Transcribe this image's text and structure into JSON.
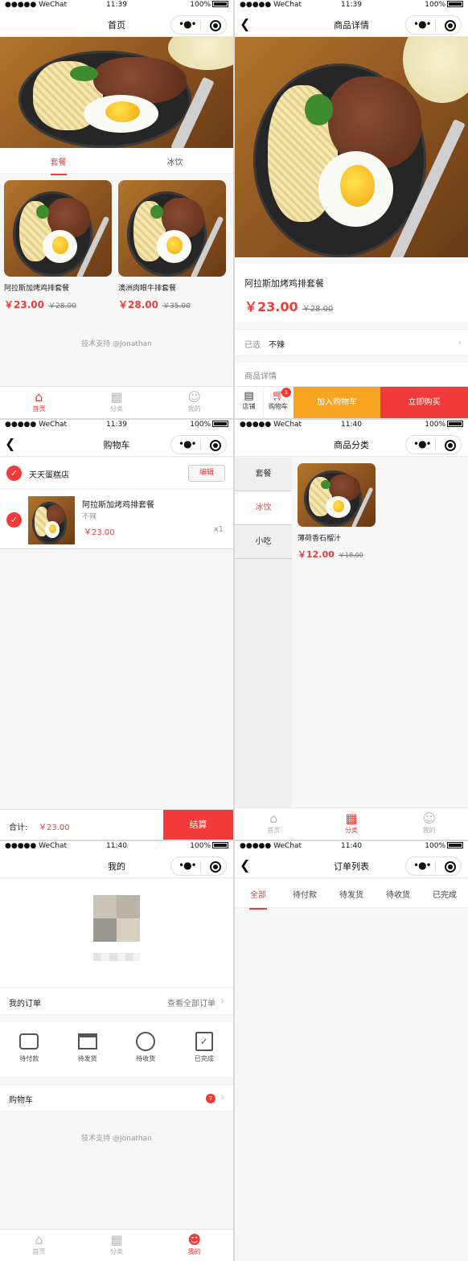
{
  "status": {
    "carrier": "●●●●● WeChat",
    "wifi": "ᯤ",
    "battery": "100%",
    "time_1": "11:39",
    "time_2": "11:39",
    "time_3": "11:39",
    "time_4": "11:40",
    "time_5": "11:40",
    "time_6": "11:40"
  },
  "home": {
    "title": "首页",
    "tabs": [
      "套餐",
      "冰饮"
    ],
    "products": [
      {
        "name": "阿拉斯加烤鸡排套餐",
        "price": "￥23.00",
        "old": "￥28.00"
      },
      {
        "name": "澳洲肉眼牛排套餐",
        "price": "￥28.00",
        "old": "￥35.00"
      }
    ],
    "footer": "技术支持 @Jonathan"
  },
  "detail": {
    "title": "商品详情",
    "name": "阿拉斯加烤鸡排套餐",
    "price": "￥23.00",
    "old": "￥28.00",
    "selected_label": "已选",
    "selected_value": "不辣",
    "detail_label": "商品详情",
    "shop": "店铺",
    "cart": "购物车",
    "cart_badge": "1",
    "add_cart": "加入购物车",
    "buy_now": "立即购买"
  },
  "cart": {
    "title": "购物车",
    "shop": "天天蛋糕店",
    "edit": "编辑",
    "item": {
      "name": "阿拉斯加烤鸡排套餐",
      "spec": "不辣",
      "price": "￥23.00",
      "qty": "x1"
    },
    "total_label": "合计:",
    "total": "￥23.00",
    "checkout": "结算"
  },
  "category": {
    "title": "商品分类",
    "cats": [
      "套餐",
      "冰饮",
      "小吃"
    ],
    "product": {
      "name": "薄荷香石榴汁",
      "price": "￥12.00",
      "old": "￥18.00"
    }
  },
  "mine": {
    "title": "我的",
    "orders_label": "我的订单",
    "view_all": "查看全部订单",
    "order_icons": [
      {
        "label": "待付款",
        "icon": "wallet-icon"
      },
      {
        "label": "待发货",
        "icon": "box-icon"
      },
      {
        "label": "待收货",
        "icon": "clock-icon"
      },
      {
        "label": "已完成",
        "icon": "clipboard-check-icon"
      }
    ],
    "cart_label": "购物车",
    "cart_badge": "7",
    "footer": "技术支持 @Jonathan"
  },
  "orders": {
    "title": "订单列表",
    "tabs": [
      "全部",
      "待付款",
      "待发货",
      "待收货",
      "已完成"
    ]
  },
  "tabbar": {
    "home": "首页",
    "category": "分类",
    "mine": "我的"
  },
  "colors": {
    "accent": "#f23a3a",
    "orange": "#f7a520"
  }
}
